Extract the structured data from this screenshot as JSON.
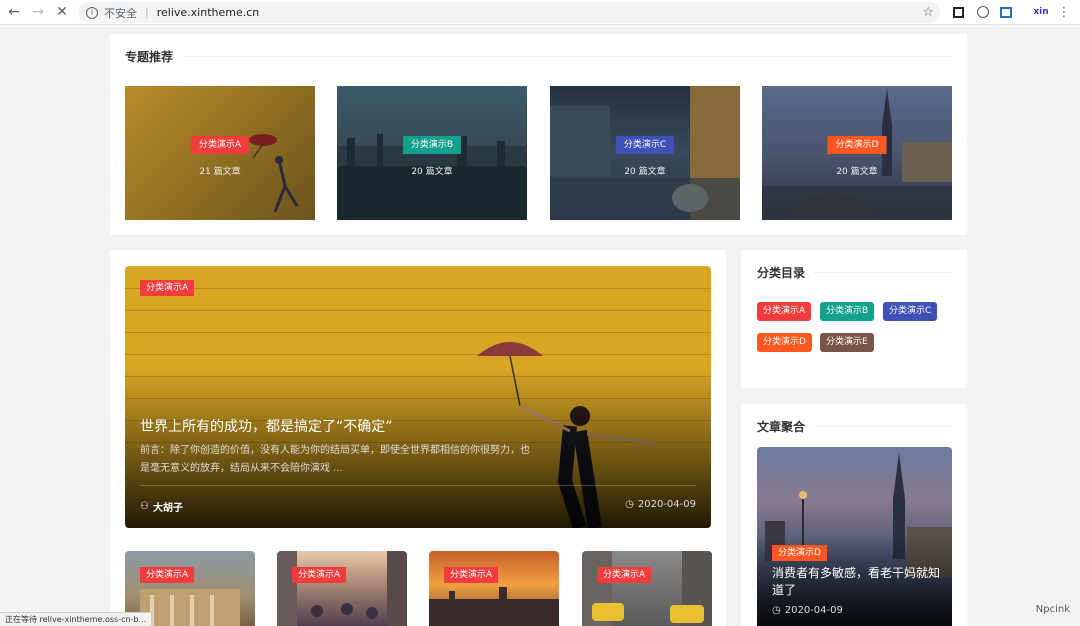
{
  "browser": {
    "insecure_label": "不安全",
    "url": "relive.xintheme.cn",
    "ext_label": "xin"
  },
  "topics": {
    "title": "专题推荐",
    "items": [
      {
        "label": "分类演示A",
        "count": "21 篇文章",
        "color": "#f03c3c"
      },
      {
        "label": "分类演示B",
        "count": "20 篇文章",
        "color": "#13a08c"
      },
      {
        "label": "分类演示C",
        "count": "20 篇文章",
        "color": "#3f51b5"
      },
      {
        "label": "分类演示D",
        "count": "20 篇文章",
        "color": "#ff5722"
      }
    ]
  },
  "hero": {
    "category": "分类演示A",
    "title": "世界上所有的成功，都是搞定了“不确定”",
    "excerpt": "前言：除了你创造的价值，没有人能为你的结局买单，即使全世界都相信的你很努力，也是毫无意义的放弃，结局从来不会陪你演戏 ...",
    "author": "大胡子",
    "date": "2020-04-09"
  },
  "thumbs": [
    {
      "label": "分类演示A"
    },
    {
      "label": "分类演示A"
    },
    {
      "label": "分类演示A"
    },
    {
      "label": "分类演示A"
    }
  ],
  "sidebar": {
    "categories_title": "分类目录",
    "tags": [
      {
        "label": "分类演示A",
        "color": "#f03c3c"
      },
      {
        "label": "分类演示B",
        "color": "#13a08c"
      },
      {
        "label": "分类演示C",
        "color": "#3f51b5"
      },
      {
        "label": "分类演示D",
        "color": "#ff5722"
      },
      {
        "label": "分类演示E",
        "color": "#795548"
      }
    ],
    "aggregate_title": "文章聚合",
    "aggregate": {
      "category": "分类演示D",
      "title": "消费者有多敏感，看老干妈就知道了",
      "date": "2020-04-09"
    }
  },
  "status_text": "正在等待 relive-xintheme.oss-cn-b...",
  "watermark": "Npcink"
}
